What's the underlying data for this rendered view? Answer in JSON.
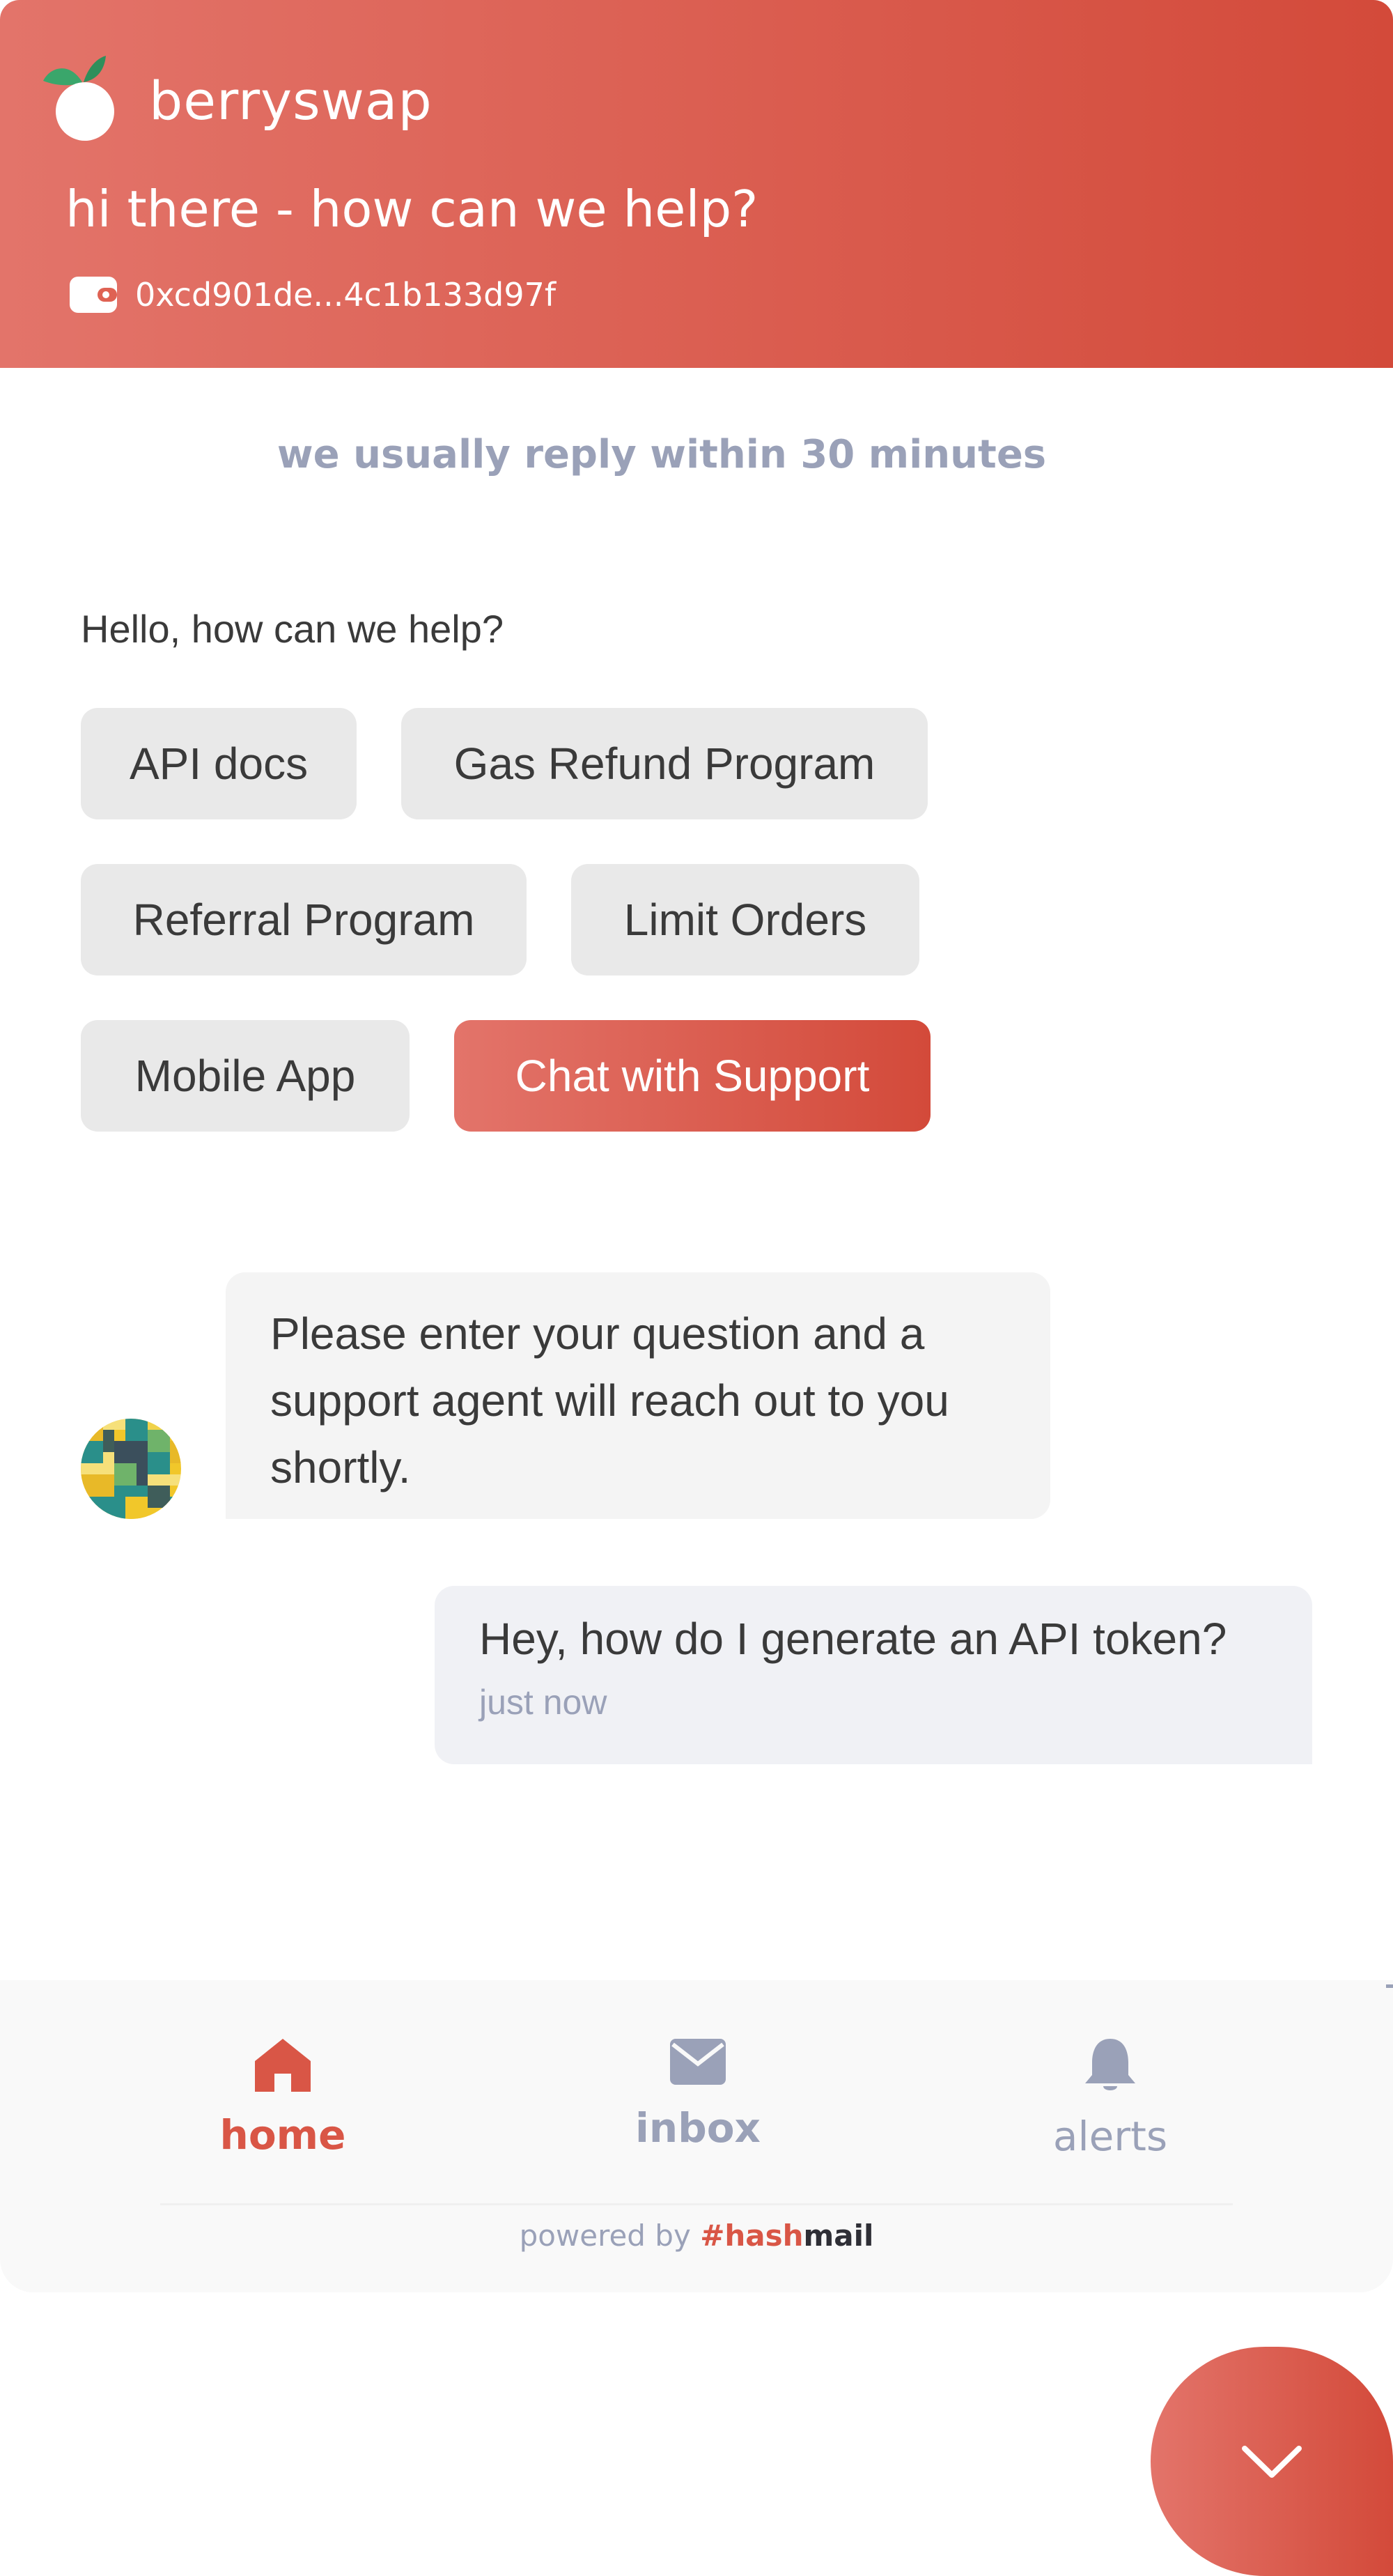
{
  "brand": {
    "name": "berryswap",
    "logo_icon": "berry-logo-icon"
  },
  "header": {
    "greeting": "hi there - how can we help?",
    "wallet_icon": "wallet-icon",
    "wallet_address": "0xcd901de...4c1b133d97f"
  },
  "reply_notice": "we usually reply within 30 minutes",
  "prompt": "Hello, how can we help?",
  "options": [
    {
      "label": "API docs"
    },
    {
      "label": "Gas Refund Program"
    },
    {
      "label": "Referral Program"
    },
    {
      "label": "Limit Orders"
    },
    {
      "label": "Mobile App"
    },
    {
      "label": "Chat with Support",
      "selected": true
    }
  ],
  "messages": {
    "agent": {
      "text": "Please enter your question and a support agent will reach out to you shortly.",
      "avatar": "pixel-avatar"
    },
    "user": {
      "text": "Hey, how do I generate an API token?",
      "time": "just now"
    }
  },
  "nav": {
    "items": [
      {
        "label": "home",
        "icon": "home-icon",
        "active": true
      },
      {
        "label": "inbox",
        "icon": "envelope-icon",
        "active": false
      },
      {
        "label": "alerts",
        "icon": "bell-icon",
        "active": false
      }
    ]
  },
  "footer": {
    "powered_by": "powered by",
    "brand_hash": "#hash",
    "brand_mail": "mail"
  },
  "fab": {
    "icon": "chevron-down-icon"
  },
  "colors": {
    "accent_start": "#e3746a",
    "accent_end": "#d34a3a",
    "muted": "#9aa1b8",
    "text": "#3a3a3a"
  }
}
